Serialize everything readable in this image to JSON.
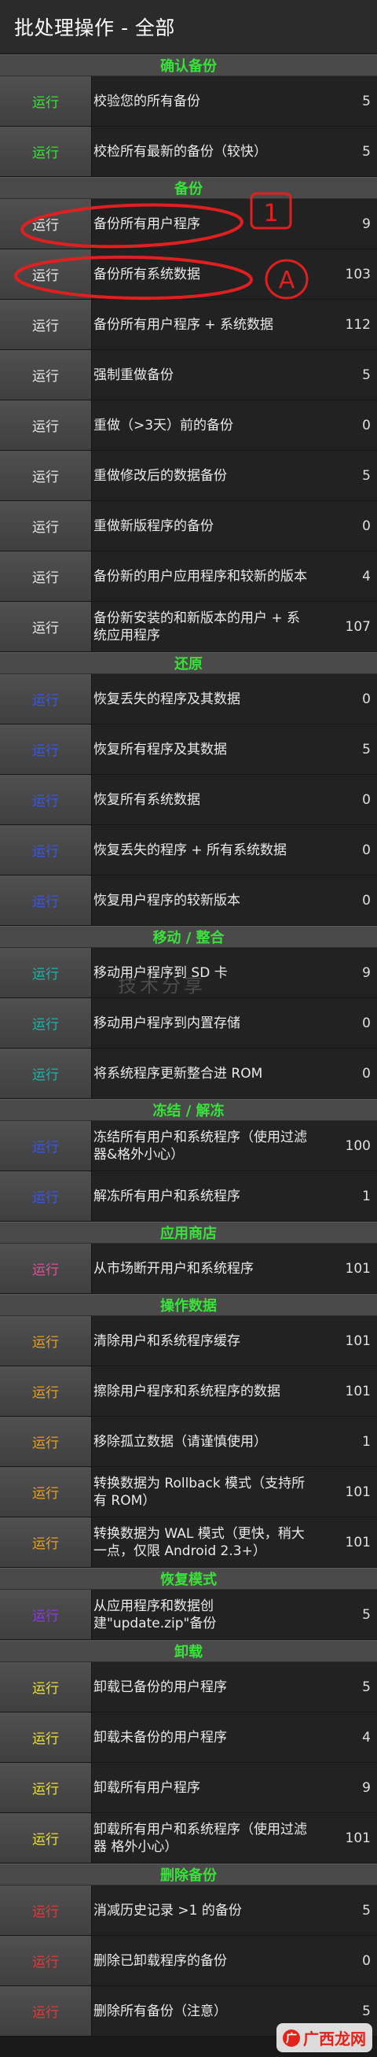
{
  "app_title": "批处理操作 - 全部",
  "colors": {
    "section_header": "#39e23a",
    "verify": "#39e23a",
    "backup": "#e8e8e8",
    "restore": "#3a56e8",
    "move": "#1fb3a8",
    "freeze": "#3a56e8",
    "market": "#e0509a",
    "data": "#e8a021",
    "recovery": "#8a3be0",
    "uninstall": "#e8e03a",
    "delete": "#e03a3a",
    "annotation": "#e02020"
  },
  "sections": [
    {
      "title": "确认备份",
      "color_key": "verify",
      "rows": [
        {
          "button": "运行",
          "label": "校验您的所有备份",
          "count": "5"
        },
        {
          "button": "运行",
          "label": "校检所有最新的备份（较快）",
          "count": "5"
        }
      ]
    },
    {
      "title": "备份",
      "color_key": "backup",
      "rows": [
        {
          "button": "运行",
          "label": "备份所有用户程序",
          "count": "9"
        },
        {
          "button": "运行",
          "label": "备份所有系统数据",
          "count": "103"
        },
        {
          "button": "运行",
          "label": "备份所有用户程序 + 系统数据",
          "count": "112"
        },
        {
          "button": "运行",
          "label": "强制重做备份",
          "count": "5"
        },
        {
          "button": "运行",
          "label": "重做（>3天）前的备份",
          "count": "0"
        },
        {
          "button": "运行",
          "label": "重做修改后的数据备份",
          "count": "5"
        },
        {
          "button": "运行",
          "label": "重做新版程序的备份",
          "count": "0"
        },
        {
          "button": "运行",
          "label": "备份新的用户应用程序和较新的版本",
          "count": "4"
        },
        {
          "button": "运行",
          "label": "备份新安装的和新版本的用户 + 系统应用程序",
          "count": "107"
        }
      ]
    },
    {
      "title": "还原",
      "color_key": "restore",
      "rows": [
        {
          "button": "运行",
          "label": "恢复丢失的程序及其数据",
          "count": "0"
        },
        {
          "button": "运行",
          "label": "恢复所有程序及其数据",
          "count": "5"
        },
        {
          "button": "运行",
          "label": "恢复所有系统数据",
          "count": "0"
        },
        {
          "button": "运行",
          "label": "恢复丢失的程序 + 所有系统数据",
          "count": "0"
        },
        {
          "button": "运行",
          "label": "恢复用户程序的较新版本",
          "count": "0"
        }
      ]
    },
    {
      "title": "移动 / 整合",
      "color_key": "move",
      "rows": [
        {
          "button": "运行",
          "label": "移动用户程序到 SD 卡",
          "count": "9"
        },
        {
          "button": "运行",
          "label": "移动用户程序到内置存储",
          "count": "0"
        },
        {
          "button": "运行",
          "label": "将系统程序更新整合进 ROM",
          "count": "0"
        }
      ]
    },
    {
      "title": "冻结 / 解冻",
      "color_key": "freeze",
      "rows": [
        {
          "button": "运行",
          "label": "冻结所有用户和系统程序（使用过滤器&格外小心）",
          "count": "100"
        },
        {
          "button": "运行",
          "label": "解冻所有用户和系统程序",
          "count": "1"
        }
      ]
    },
    {
      "title": "应用商店",
      "color_key": "market",
      "rows": [
        {
          "button": "运行",
          "label": "从市场断开用户和系统程序",
          "count": "101"
        }
      ]
    },
    {
      "title": "操作数据",
      "color_key": "data",
      "rows": [
        {
          "button": "运行",
          "label": "清除用户和系统程序缓存",
          "count": "101"
        },
        {
          "button": "运行",
          "label": "擦除用户程序和系统程序的数据",
          "count": "101"
        },
        {
          "button": "运行",
          "label": "移除孤立数据（请谨慎使用）",
          "count": "1"
        },
        {
          "button": "运行",
          "label": "转换数据为 Rollback 模式（支持所有 ROM）",
          "count": "101"
        },
        {
          "button": "运行",
          "label": "转换数据为 WAL 模式（更快，稍大一点，仅限 Android 2.3+）",
          "count": "101"
        }
      ]
    },
    {
      "title": "恢复模式",
      "color_key": "recovery",
      "rows": [
        {
          "button": "运行",
          "label": "从应用程序和数据创建\"update.zip\"备份",
          "count": "5"
        }
      ]
    },
    {
      "title": "卸载",
      "color_key": "uninstall",
      "rows": [
        {
          "button": "运行",
          "label": "卸载已备份的用户程序",
          "count": "5"
        },
        {
          "button": "运行",
          "label": "卸载未备份的用户程序",
          "count": "4"
        },
        {
          "button": "运行",
          "label": "卸载所有用户程序",
          "count": "9"
        },
        {
          "button": "运行",
          "label": "卸载所有用户和系统程序（使用过滤器 格外小心）",
          "count": "101"
        }
      ]
    },
    {
      "title": "删除备份",
      "color_key": "delete",
      "rows": [
        {
          "button": "运行",
          "label": "消减历史记录 >1 的备份",
          "count": "5"
        },
        {
          "button": "运行",
          "label": "删除已卸载程序的备份",
          "count": "0"
        },
        {
          "button": "运行",
          "label": "删除所有备份（注意）",
          "count": "5"
        }
      ]
    }
  ],
  "annotations": {
    "mark_1": "1",
    "mark_a": "A"
  },
  "watermark": "技术分享",
  "logo": {
    "mark": "广",
    "text": "广西龙网"
  }
}
